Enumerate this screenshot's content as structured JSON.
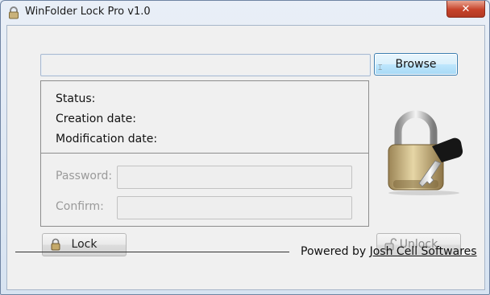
{
  "window": {
    "title": "WinFolder Lock Pro v1.0",
    "close_label": "✕"
  },
  "path_input": {
    "value": ""
  },
  "browse_button": {
    "label": "Browse"
  },
  "info": {
    "status_label": "Status:",
    "creation_label": "Creation date:",
    "modification_label": "Modification date:"
  },
  "password": {
    "label": "Password:",
    "value": ""
  },
  "confirm": {
    "label": "Confirm:",
    "value": ""
  },
  "lock_button": {
    "label": "Lock"
  },
  "unlock_button": {
    "label": "Unlock"
  },
  "footer": {
    "prefix": "Powered by",
    "link": "Josh Cell Softwares"
  }
}
